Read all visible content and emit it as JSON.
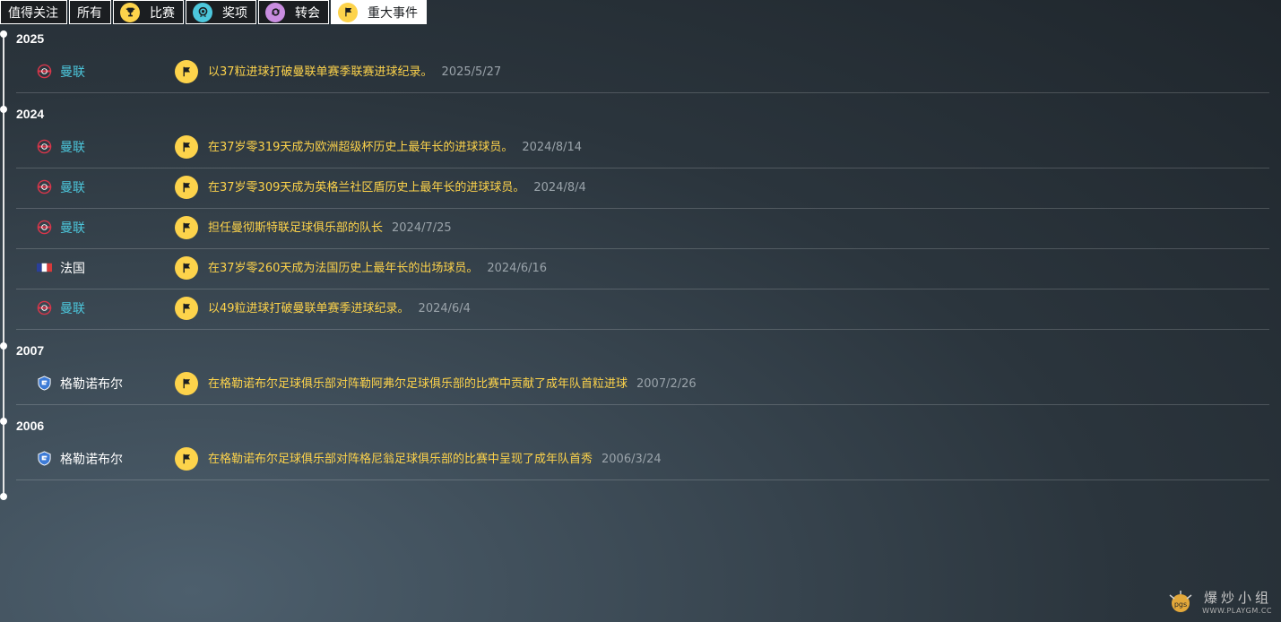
{
  "filters": [
    {
      "label": "值得关注",
      "icon": null,
      "active": false
    },
    {
      "label": "所有",
      "icon": null,
      "active": false
    },
    {
      "label": "比赛",
      "icon": "trophy-icon",
      "color": "#fdd34b",
      "active": false
    },
    {
      "label": "奖项",
      "icon": "medal-icon",
      "color": "#4cc7dc",
      "active": false
    },
    {
      "label": "转会",
      "icon": "transfer-icon",
      "color": "#c98de0",
      "active": false
    },
    {
      "label": "重大事件",
      "icon": "flag-icon",
      "color": "#fdd34b",
      "active": true
    }
  ],
  "years": [
    {
      "year": "2025",
      "events": [
        {
          "club": "曼联",
          "club_icon": "man-utd-crest-icon",
          "club_type": "mu",
          "text": "以37粒进球打破曼联单赛季联赛进球纪录。",
          "date": "2025/5/27"
        }
      ]
    },
    {
      "year": "2024",
      "events": [
        {
          "club": "曼联",
          "club_icon": "man-utd-crest-icon",
          "club_type": "mu",
          "text": "在37岁零319天成为欧洲超级杯历史上最年长的进球球员。",
          "date": "2024/8/14"
        },
        {
          "club": "曼联",
          "club_icon": "man-utd-crest-icon",
          "club_type": "mu",
          "text": "在37岁零309天成为英格兰社区盾历史上最年长的进球球员。",
          "date": "2024/8/4"
        },
        {
          "club": "曼联",
          "club_icon": "man-utd-crest-icon",
          "club_type": "mu",
          "text": "担任曼彻斯特联足球俱乐部的队长",
          "date": "2024/7/25"
        },
        {
          "club": "法国",
          "club_icon": "france-flag-icon",
          "club_type": "other",
          "text": "在37岁零260天成为法国历史上最年长的出场球员。",
          "date": "2024/6/16"
        },
        {
          "club": "曼联",
          "club_icon": "man-utd-crest-icon",
          "club_type": "mu",
          "text": "以49粒进球打破曼联单赛季进球纪录。",
          "date": "2024/6/4"
        }
      ]
    },
    {
      "year": "2007",
      "events": [
        {
          "club": "格勒诺布尔",
          "club_icon": "grenoble-crest-icon",
          "club_type": "other",
          "text": "在格勒诺布尔足球俱乐部对阵勒阿弗尔足球俱乐部的比赛中贡献了成年队首粒进球",
          "date": "2007/2/26"
        }
      ]
    },
    {
      "year": "2006",
      "events": [
        {
          "club": "格勒诺布尔",
          "club_icon": "grenoble-crest-icon",
          "club_type": "other",
          "text": "在格勒诺布尔足球俱乐部对阵格尼翁足球俱乐部的比赛中呈现了成年队首秀",
          "date": "2006/3/24"
        }
      ]
    }
  ],
  "watermark": {
    "cn": "爆炒小组",
    "url": "WWW.PLAYGM.CC",
    "logo_text": "pgs"
  },
  "colors": {
    "accent_yellow": "#fdd34b",
    "mu_cyan": "#4cc7dc",
    "date_gray": "#9aa3aa"
  }
}
